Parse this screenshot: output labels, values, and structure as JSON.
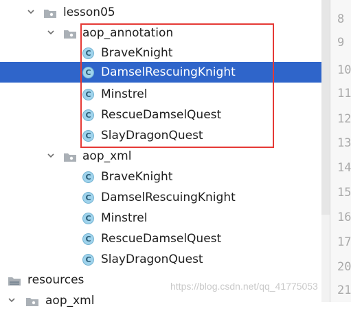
{
  "tree": {
    "rows": [
      {
        "label": "lesson05",
        "icon": "package-folder-icon",
        "expanded": true
      },
      {
        "label": "aop_annotation",
        "icon": "package-folder-icon",
        "expanded": true
      },
      {
        "label": "BraveKnight",
        "icon": "class-icon",
        "badge": "C"
      },
      {
        "label": "DamselRescuingKnight",
        "icon": "class-icon",
        "badge": "C",
        "selected": true
      },
      {
        "label": "Minstrel",
        "icon": "class-icon",
        "badge": "C"
      },
      {
        "label": "RescueDamselQuest",
        "icon": "class-icon",
        "badge": "C"
      },
      {
        "label": "SlayDragonQuest",
        "icon": "class-icon",
        "badge": "C"
      },
      {
        "label": "aop_xml",
        "icon": "package-folder-icon",
        "expanded": true
      },
      {
        "label": "BraveKnight",
        "icon": "class-icon",
        "badge": "C"
      },
      {
        "label": "DamselRescuingKnight",
        "icon": "class-icon",
        "badge": "C"
      },
      {
        "label": "Minstrel",
        "icon": "class-icon",
        "badge": "C"
      },
      {
        "label": "RescueDamselQuest",
        "icon": "class-icon",
        "badge": "C"
      },
      {
        "label": "SlayDragonQuest",
        "icon": "class-icon",
        "badge": "C"
      },
      {
        "label": "resources",
        "icon": "resources-folder-icon"
      },
      {
        "label": "aop_xml",
        "icon": "package-folder-icon",
        "expanded": true
      }
    ]
  },
  "gutter": {
    "line_numbers": [
      "8",
      "9",
      "10",
      "11",
      "12",
      "13",
      "14",
      "15",
      "16",
      "17",
      "20",
      "21"
    ]
  },
  "watermark": "https://blog.csdn.net/qq_41775053",
  "colors": {
    "selection": "#2f65ca",
    "highlight_box": "#e53935",
    "class_icon": "#9fd3ec"
  }
}
